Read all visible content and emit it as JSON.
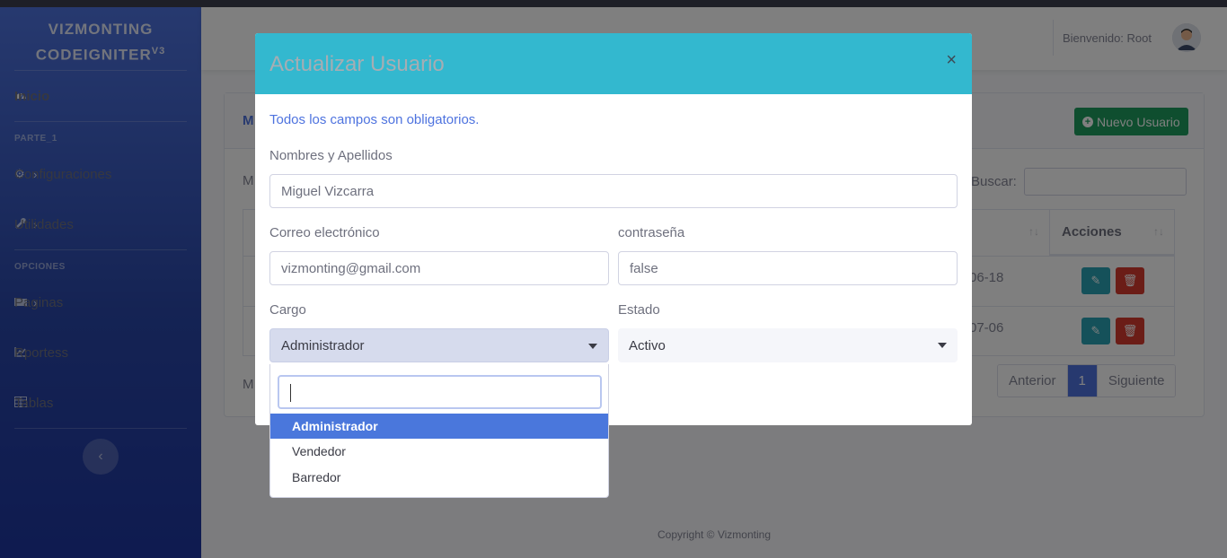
{
  "brand": {
    "line1": "VIZMONTING",
    "line2": "CODEIGNITER",
    "sup": "V3"
  },
  "sidebar": {
    "inicio": "Inicio",
    "heading1": "PARTE_1",
    "items1": [
      {
        "label": "Configuraciones",
        "icon": "gear-icon"
      },
      {
        "label": "Utilidades",
        "icon": "wrench-icon"
      }
    ],
    "heading2": "OPCIONES",
    "items2": [
      {
        "label": "Paginas",
        "icon": "folder-icon"
      },
      {
        "label": "Rportess",
        "icon": "chart-icon"
      },
      {
        "label": "Tablas",
        "icon": "table-icon"
      }
    ],
    "toggle_icon": "chevron-left-icon"
  },
  "topbar": {
    "welcome": "Bienvenido: Root"
  },
  "card": {
    "title_fragment": "M",
    "new_button": "Nuevo Usuario",
    "show_fragment": "M",
    "search_label": "Buscar:",
    "actions_header": "Acciones",
    "rows": [
      {
        "date_fragment": "06-18"
      },
      {
        "date_fragment": "07-06"
      }
    ],
    "info_fragment": "M",
    "pagination": {
      "prev": "Anterior",
      "current": "1",
      "next": "Siguiente"
    }
  },
  "footer": "Copyright © Vizmonting",
  "modal": {
    "title": "Actualizar Usuario",
    "close": "×",
    "note": "Todos los campos son obligatorios.",
    "name_label": "Nombres y Apellidos",
    "name_value": "Miguel Vizcarra",
    "email_label": "Correo electrónico",
    "email_value": "vizmonting@gmail.com",
    "password_label": "contraseña",
    "password_value": "false",
    "cargo_label": "Cargo",
    "cargo_value": "Administrador",
    "estado_label": "Estado",
    "estado_value": "Activo",
    "cargo_options": [
      "Administrador",
      "Vendedor",
      "Barredor"
    ]
  },
  "colors": {
    "primary": "#4e73df",
    "modal_header": "#33b8cf",
    "success": "#1f9d5e",
    "info": "#2ba3b4",
    "danger": "#d63b2f"
  }
}
